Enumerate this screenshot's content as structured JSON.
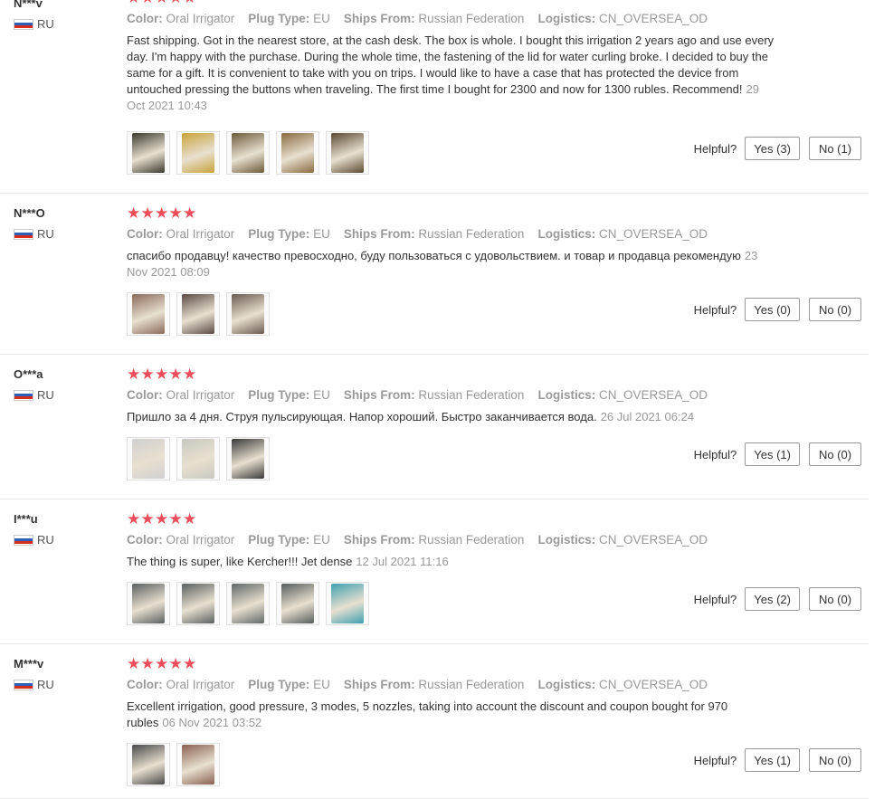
{
  "labels": {
    "color": "Color:",
    "plug_type": "Plug Type:",
    "ships_from": "Ships From:",
    "logistics": "Logistics:",
    "helpful": "Helpful?"
  },
  "colors": {
    "star": "#ef4c5a",
    "meta_text": "#999999",
    "body_text": "#333333",
    "divider": "#e8e8e8"
  },
  "reviews": [
    {
      "user": "N***v",
      "country": "RU",
      "rating": 5,
      "color": "Oral Irrigator",
      "plug_type": "EU",
      "ships_from": "Russian Federation",
      "logistics": "CN_OVERSEA_OD",
      "text": "Fast shipping. Got in the nearest store, at the cash desk. The box is whole. I bought this irrigation 2 years ago and use every day. I'm happy with the purchase. During the whole time, the fastening of the lid for water curling broke. I decided to buy the same for a gift. It is convenient to take with you on trips. I would like to have a case that has protected the device from untouched pressing the buttons when traveling. The first time I bought for 2300 and now for 1300 rubles. Recommend!",
      "date": "29 Oct 2021 10:43",
      "photos": 5,
      "yes": "Yes (3)",
      "no": "No (1)"
    },
    {
      "user": "N***O",
      "country": "RU",
      "rating": 5,
      "color": "Oral Irrigator",
      "plug_type": "EU",
      "ships_from": "Russian Federation",
      "logistics": "CN_OVERSEA_OD",
      "text": "спасибо продавцу! качество превосходно, буду пользоваться с удовольствием. и товар и продавца рекомендую",
      "date": "23 Nov 2021 08:09",
      "photos": 3,
      "yes": "Yes (0)",
      "no": "No (0)"
    },
    {
      "user": "O***a",
      "country": "RU",
      "rating": 5,
      "color": "Oral Irrigator",
      "plug_type": "EU",
      "ships_from": "Russian Federation",
      "logistics": "CN_OVERSEA_OD",
      "text": "Пришло за 4 дня. Струя пульсирующая. Напор хороший. Быстро заканчивается вода.",
      "date": "26 Jul 2021 06:24",
      "photos": 3,
      "yes": "Yes (1)",
      "no": "No (0)"
    },
    {
      "user": "I***u",
      "country": "RU",
      "rating": 5,
      "color": "Oral Irrigator",
      "plug_type": "EU",
      "ships_from": "Russian Federation",
      "logistics": "CN_OVERSEA_OD",
      "text": "The thing is super, like Kercher!!! Jet dense",
      "date": "12 Jul 2021 11:16",
      "photos": 5,
      "yes": "Yes (2)",
      "no": "No (0)"
    },
    {
      "user": "M***v",
      "country": "RU",
      "rating": 5,
      "color": "Oral Irrigator",
      "plug_type": "EU",
      "ships_from": "Russian Federation",
      "logistics": "CN_OVERSEA_OD",
      "text": "Excellent irrigation, good pressure, 3 modes, 5 nozzles, taking into account the discount and coupon bought for 970 rubles",
      "date": "06 Nov 2021 03:52",
      "photos": 2,
      "yes": "Yes (1)",
      "no": "No (0)"
    }
  ]
}
